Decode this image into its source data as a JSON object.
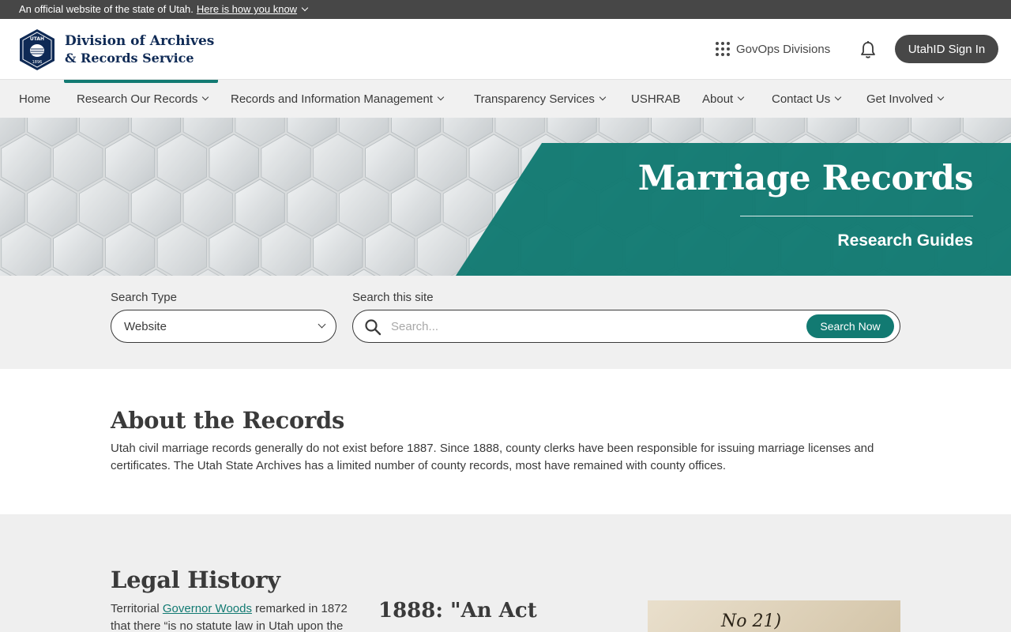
{
  "gov_banner": {
    "text": "An official website of the state of Utah.",
    "link": "Here is how you know"
  },
  "header": {
    "logo_seal_text": {
      "top": "UTAH",
      "year": "1896"
    },
    "logo_line1": "Division of Archives",
    "logo_line2": "& Records Service",
    "govops_label": "GovOps Divisions",
    "govops_icon": "grid-dots-icon",
    "bell_icon": "bell-icon",
    "signin_label": "UtahID Sign In"
  },
  "nav": {
    "active_index": 1,
    "items": [
      {
        "label": "Home",
        "dropdown": false
      },
      {
        "label": "Research Our Records",
        "dropdown": true
      },
      {
        "label": "Records and Information Management",
        "dropdown": true
      },
      {
        "label": "Transparency Services",
        "dropdown": true
      },
      {
        "label": "USHRAB",
        "dropdown": false
      },
      {
        "label": "About",
        "dropdown": true
      },
      {
        "label": "Contact Us",
        "dropdown": true
      },
      {
        "label": "Get Involved",
        "dropdown": true
      }
    ]
  },
  "hero": {
    "title": "Marriage Records",
    "subtitle": "Research Guides"
  },
  "search": {
    "type_label": "Search Type",
    "type_value": "Website",
    "site_label": "Search this site",
    "placeholder": "Search...",
    "button_label": "Search Now",
    "icon": "search-icon"
  },
  "about": {
    "heading": "About the Records",
    "body": "Utah civil marriage records generally do not exist before 1887. Since 1888, county clerks have been responsible for issuing marriage licenses and certificates. The Utah State Archives has a limited number of county records, most have remained with county offices."
  },
  "legal": {
    "heading": "Legal History",
    "col1_before": "Territorial ",
    "col1_link": "Governor Woods",
    "col1_after": " remarked in 1872 that there “is no statute law in Utah upon the",
    "col2_heading": "1888: \"An Act",
    "doc_scribble": "No 21)"
  },
  "colors": {
    "teal": "#127a72",
    "navy": "#0f2a55",
    "banner_gray": "#474747"
  }
}
